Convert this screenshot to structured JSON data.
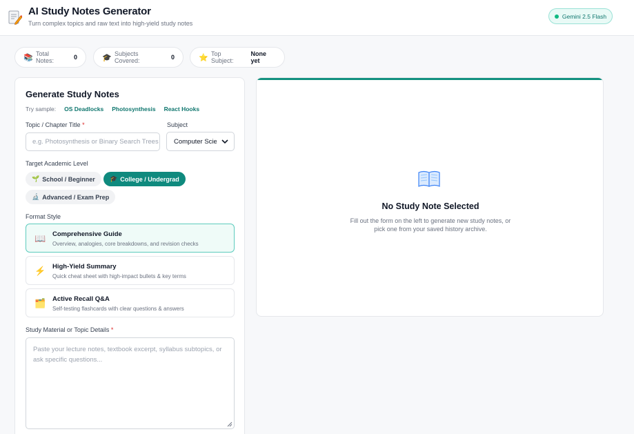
{
  "header": {
    "title": "AI Study Notes Generator",
    "subtitle": "Turn complex topics and raw text into high-yield study notes",
    "model_badge": "Gemini 2.5 Flash",
    "logo_icon": "notepad-pencil-icon"
  },
  "stats": {
    "total_notes": {
      "label": "Total Notes:",
      "value": "0",
      "icon": "books-icon"
    },
    "subjects_covered": {
      "label": "Subjects Covered:",
      "value": "0",
      "icon": "graduation-cap-icon"
    },
    "top_subject": {
      "label": "Top Subject:",
      "value": "None yet",
      "icon": "star-icon"
    }
  },
  "form": {
    "title": "Generate Study Notes",
    "try_sample_label": "Try sample:",
    "samples": [
      "OS Deadlocks",
      "Photosynthesis",
      "React Hooks"
    ],
    "topic_label": "Topic / Chapter Title",
    "required_marker": "*",
    "topic_placeholder": "e.g. Photosynthesis or Binary Search Trees",
    "subject_label": "Subject",
    "subject_value": "Computer Science",
    "level_label": "Target Academic Level",
    "levels": [
      {
        "label": "School / Beginner",
        "icon": "seedling-icon",
        "selected": false
      },
      {
        "label": "College / Undergrad",
        "icon": "graduation-cap-icon",
        "selected": true
      },
      {
        "label": "Advanced / Exam Prep",
        "icon": "microscope-icon",
        "selected": false
      }
    ],
    "format_label": "Format Style",
    "formats": [
      {
        "title": "Comprehensive Guide",
        "desc": "Overview, analogies, core breakdowns, and revision checks",
        "icon": "open-book-icon",
        "selected": true
      },
      {
        "title": "High-Yield Summary",
        "desc": "Quick cheat sheet with high-impact bullets & key terms",
        "icon": "lightning-icon",
        "selected": false
      },
      {
        "title": "Active Recall Q&A",
        "desc": "Self-testing flashcards with clear questions & answers",
        "icon": "card-box-icon",
        "selected": false
      }
    ],
    "material_label": "Study Material or Topic Details",
    "material_placeholder": "Paste your lecture notes, textbook excerpt, syllabus subtopics, or ask specific questions..."
  },
  "empty_state": {
    "icon": "open-book-icon",
    "title": "No Study Note Selected",
    "description": "Fill out the form on the left to generate new study notes, or pick one from your saved history archive."
  },
  "colors": {
    "accent": "#0f8a7e",
    "accent_light": "#effbf8",
    "badge_text": "#0f766e",
    "required": "#dc2626"
  }
}
